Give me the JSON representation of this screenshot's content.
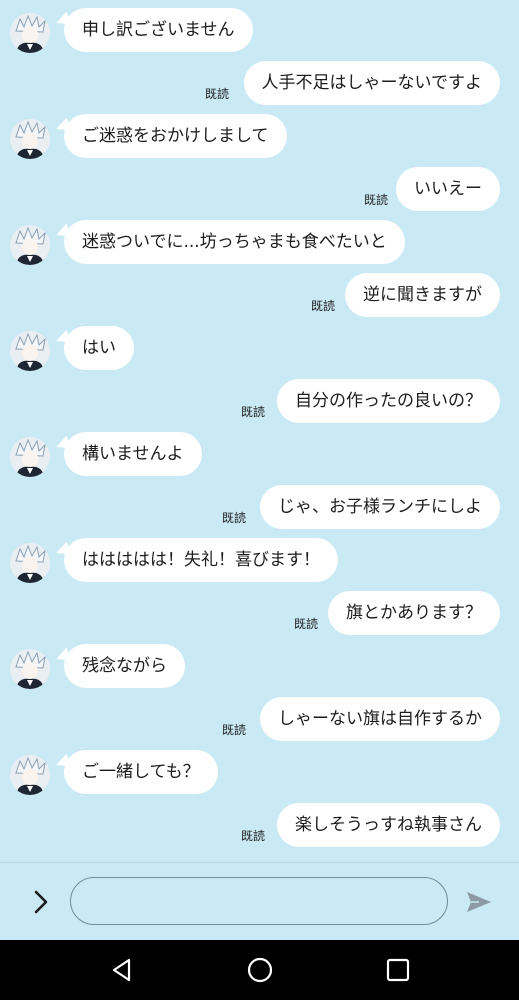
{
  "messages": [
    {
      "side": "left",
      "text": "申し訳ございません",
      "avatar_icon": "character-avatar-icon"
    },
    {
      "side": "right",
      "text": "人手不足はしゃーないですよ",
      "read": "既読"
    },
    {
      "side": "left",
      "text": "ご迷惑をおかけしまして",
      "avatar_icon": "character-avatar-icon"
    },
    {
      "side": "right",
      "text": "いいえー",
      "read": "既読"
    },
    {
      "side": "left",
      "text": "迷惑ついでに...坊っちゃまも食べたいと",
      "avatar_icon": "character-avatar-icon"
    },
    {
      "side": "right",
      "text": "逆に聞きますが",
      "read": "既読"
    },
    {
      "side": "left",
      "text": "はい",
      "avatar_icon": "character-avatar-icon"
    },
    {
      "side": "right",
      "text": "自分の作ったの良いの？",
      "read": "既読"
    },
    {
      "side": "left",
      "text": "構いませんよ",
      "avatar_icon": "character-avatar-icon"
    },
    {
      "side": "right",
      "text": "じゃ、お子様ランチにしよ",
      "read": "既読"
    },
    {
      "side": "left",
      "text": "ははははは！失礼！喜びます！",
      "avatar_icon": "character-avatar-icon"
    },
    {
      "side": "right",
      "text": "旗とかあります？",
      "read": "既読"
    },
    {
      "side": "left",
      "text": "残念ながら",
      "avatar_icon": "character-avatar-icon"
    },
    {
      "side": "right",
      "text": "しゃーない旗は自作するか",
      "read": "既読"
    },
    {
      "side": "left",
      "text": "ご一緒しても？",
      "avatar_icon": "character-avatar-icon"
    },
    {
      "side": "right",
      "text": "楽しそうっすね執事さん",
      "read": "既読"
    }
  ],
  "composer": {
    "expand_icon": "chevron-right-icon",
    "input_value": "",
    "input_placeholder": "",
    "send_icon": "send-icon"
  },
  "navbar": {
    "back_icon": "back-triangle-icon",
    "home_icon": "home-circle-icon",
    "recents_icon": "recents-square-icon"
  },
  "colors": {
    "background": "#c9e9f5",
    "bubble": "#ffffff",
    "navbar": "#000000"
  }
}
